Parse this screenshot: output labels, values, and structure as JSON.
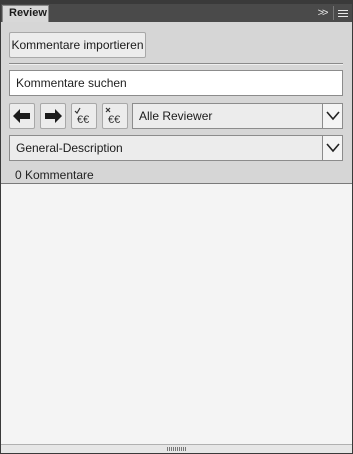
{
  "panel": {
    "tab_title": "Review",
    "collapse_glyph": ">>",
    "menu_icon": "hamburger-menu-icon"
  },
  "toolbar": {
    "import_button_label": "Kommentare importieren",
    "search_value": "Kommentare suchen",
    "prev_icon": "arrow-left-icon",
    "next_icon": "arrow-right-icon",
    "accept_icon": "accept-comment-icon",
    "reject_icon": "reject-comment-icon",
    "reviewer_filter": {
      "selected": "Alle Reviewer"
    },
    "view_filter": {
      "selected": "General-Description"
    }
  },
  "status": {
    "comment_count_label": "0 Kommentare"
  },
  "colors": {
    "frame": "#3a3a3a",
    "tabbar": "#4a4a4a",
    "panel_bg": "#d6d6d6",
    "list_bg": "#f4f4f4"
  }
}
